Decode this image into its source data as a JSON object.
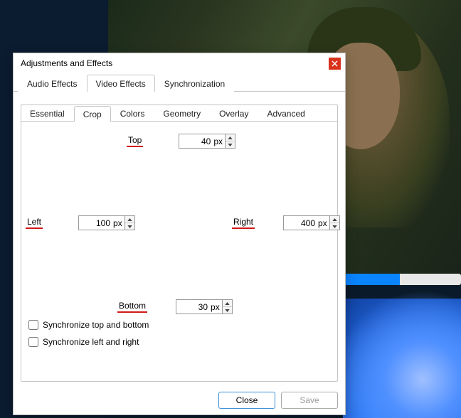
{
  "dialog": {
    "title": "Adjustments and Effects",
    "close_icon": "close-icon"
  },
  "main_tabs": [
    {
      "label": "Audio Effects",
      "active": false
    },
    {
      "label": "Video Effects",
      "active": true
    },
    {
      "label": "Synchronization",
      "active": false
    }
  ],
  "sub_tabs": [
    {
      "label": "Essential",
      "active": false
    },
    {
      "label": "Crop",
      "active": true
    },
    {
      "label": "Colors",
      "active": false
    },
    {
      "label": "Geometry",
      "active": false
    },
    {
      "label": "Overlay",
      "active": false
    },
    {
      "label": "Advanced",
      "active": false
    }
  ],
  "crop": {
    "top": {
      "label": "Top",
      "value": "40",
      "unit": "px"
    },
    "left": {
      "label": "Left",
      "value": "100",
      "unit": "px"
    },
    "right": {
      "label": "Right",
      "value": "400",
      "unit": "px"
    },
    "bottom": {
      "label": "Bottom",
      "value": "30",
      "unit": "px"
    },
    "sync_tb": {
      "label": "Synchronize top and bottom",
      "checked": false
    },
    "sync_lr": {
      "label": "Synchronize left and right",
      "checked": false
    }
  },
  "footer": {
    "close": "Close",
    "save": "Save"
  }
}
